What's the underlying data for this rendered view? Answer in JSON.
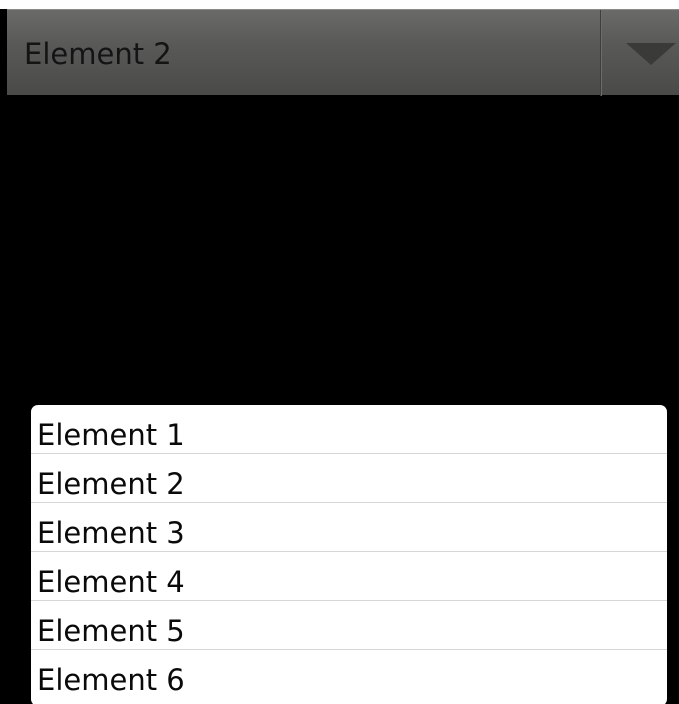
{
  "spinner": {
    "selected_value": "Element 2",
    "arrow_icon": "dropdown-arrow-icon"
  },
  "list": {
    "items": [
      {
        "label": "Element 1"
      },
      {
        "label": "Element 2"
      },
      {
        "label": "Element 3"
      },
      {
        "label": "Element 4"
      },
      {
        "label": "Element 5"
      },
      {
        "label": "Element 6"
      }
    ]
  },
  "colors": {
    "background": "#000000",
    "spinner_bar": "#595a57",
    "popup_background": "#ffffff",
    "list_divider": "#d6d6d6",
    "text": "#141414"
  }
}
